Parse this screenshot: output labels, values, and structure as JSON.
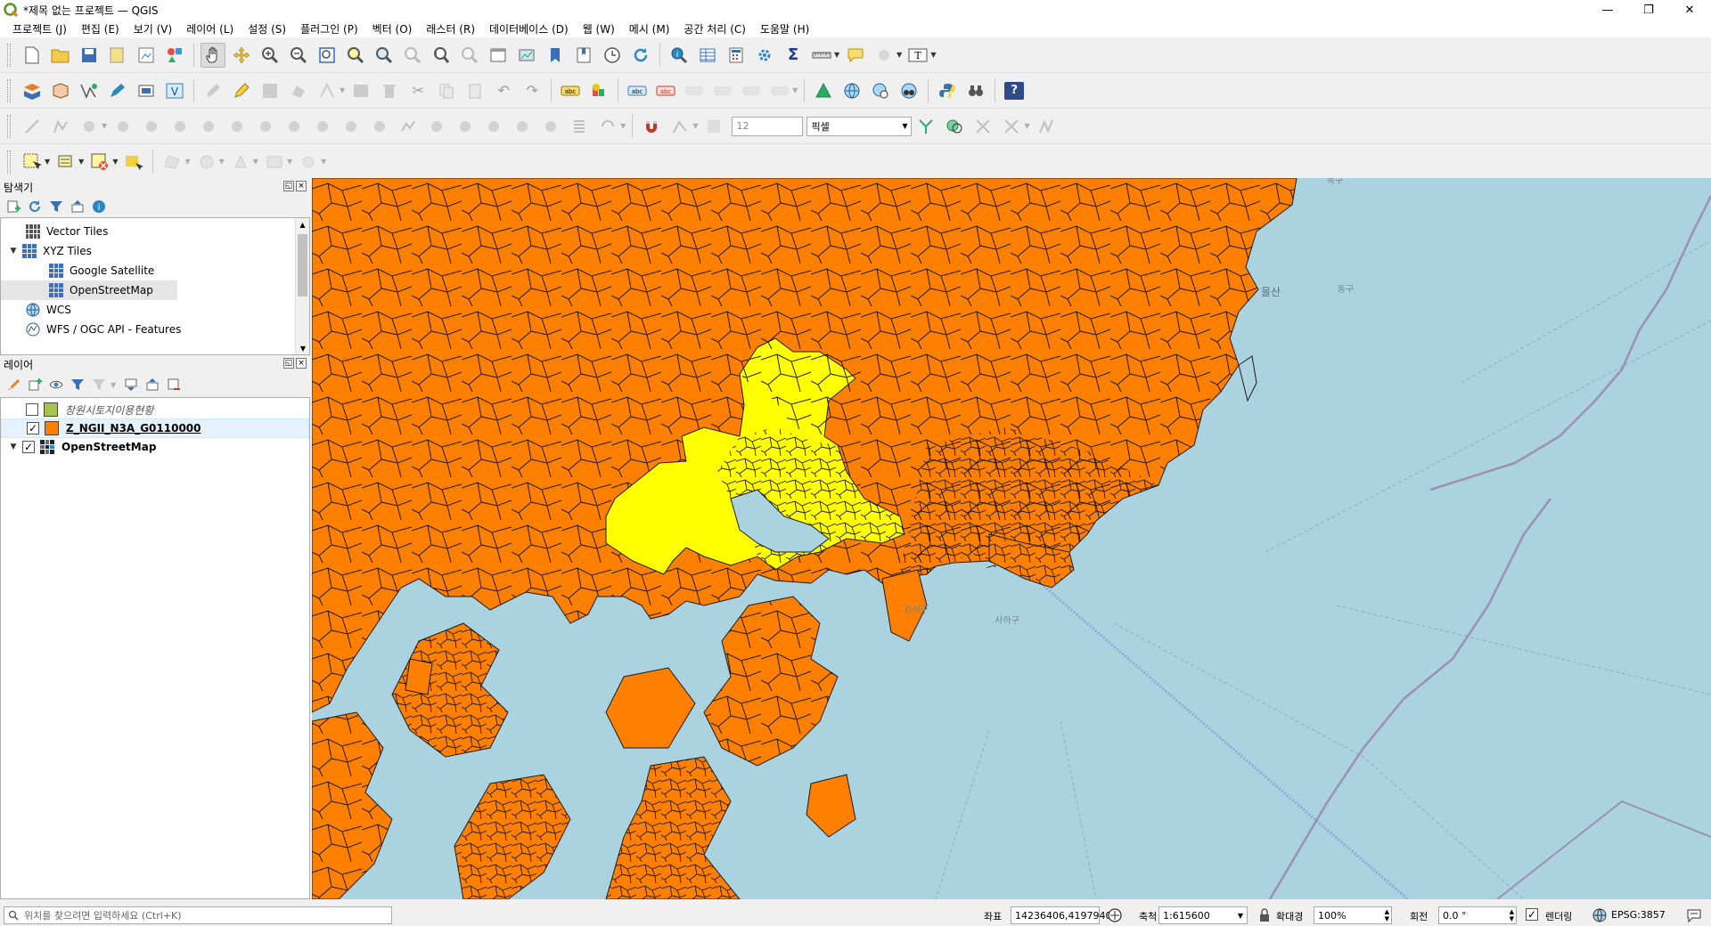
{
  "window": {
    "title": "*제목 없는 프로젝트 — QGIS",
    "controls": [
      "—",
      "❐",
      "✕"
    ]
  },
  "menus": [
    "프로젝트 (J)",
    "편집 (E)",
    "보기 (V)",
    "레이어 (L)",
    "설정 (S)",
    "플러그인 (P)",
    "벡터 (O)",
    "래스터 (R)",
    "데이터베이스 (D)",
    "웹 (W)",
    "메시 (M)",
    "공간 처리 (C)",
    "도움말 (H)"
  ],
  "digitizing": {
    "snap_tolerance": "12",
    "snap_units": "픽셀"
  },
  "browser_panel": {
    "title": "탐색기",
    "items": [
      {
        "label": "Vector Tiles"
      },
      {
        "label": "XYZ Tiles"
      },
      {
        "label": "Google Satellite"
      },
      {
        "label": "OpenStreetMap"
      },
      {
        "label": "WCS"
      },
      {
        "label": "WFS / OGC API - Features"
      }
    ]
  },
  "layers_panel": {
    "title": "레이어",
    "layers": [
      {
        "name": "창원시토지이용현황",
        "checked": false,
        "color": "#a6c34d"
      },
      {
        "name": "Z_NGII_N3A_G0110000",
        "checked": true,
        "color": "#ff7f00"
      },
      {
        "name": "OpenStreetMap",
        "checked": true,
        "color": "raster-icon"
      }
    ]
  },
  "map": {
    "labels": [
      "울산",
      "동구",
      "강서구",
      "사하구",
      "북구"
    ],
    "colors": {
      "sea": "#aad3df",
      "polygons": "#ff7f00",
      "selected": "#ffff00"
    }
  },
  "statusbar": {
    "search_placeholder": "위치를 찾으려면 입력하세요 (Ctrl+K)",
    "coordinate_label": "좌표",
    "coordinate_value": "14236406,4197940",
    "scale_label": "축척",
    "scale_value": "1:615600",
    "magnifier_label": "확대경",
    "magnifier_value": "100%",
    "rotation_label": "회전",
    "rotation_value": "0.0 °",
    "render_label": "렌더링",
    "crs": "EPSG:3857"
  }
}
